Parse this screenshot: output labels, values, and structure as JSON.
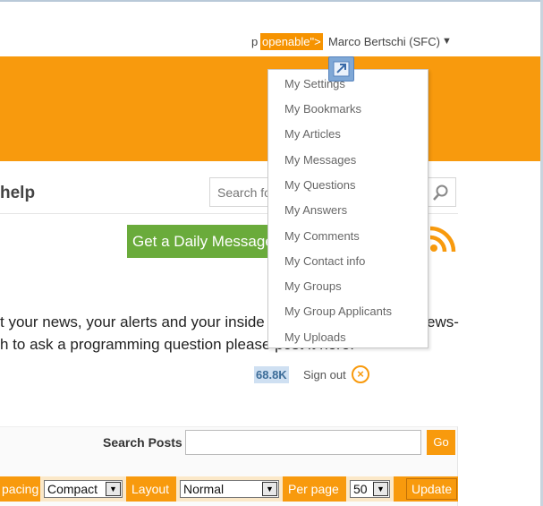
{
  "member_bar": {
    "prefix": "p",
    "snippet": "openable\">",
    "user_name": "Marco Bertschi (SFC)",
    "caret": "▼"
  },
  "menu": {
    "items": [
      "My Settings",
      "My Bookmarks",
      "My Articles",
      "My Messages",
      "My Questions",
      "My Answers",
      "My Comments",
      "My Contact info",
      "My Groups",
      "My Group Applicants",
      "My Uploads"
    ]
  },
  "header": {
    "title": "help",
    "search_placeholder": "Search fo"
  },
  "daily_button": "Get a Daily Message",
  "paragraph": {
    "line1": "t your news, your alerts and your inside",
    "line1_tail": "ews-",
    "line2": "h to ask a programming question please post it here."
  },
  "account": {
    "reputation": "68.8K",
    "signout": "Sign out"
  },
  "posts": {
    "search_label": "Search Posts",
    "go": "Go",
    "spacing_label": "pacing",
    "spacing_value": "Compact",
    "layout_label": "Layout",
    "layout_value": "Normal",
    "per_page_label": "Per page",
    "per_page_value": "50",
    "update": "Update"
  },
  "colors": {
    "brand_orange": "#f89a0d",
    "green": "#6aab3b",
    "rep_bg": "#cfe0f2"
  }
}
